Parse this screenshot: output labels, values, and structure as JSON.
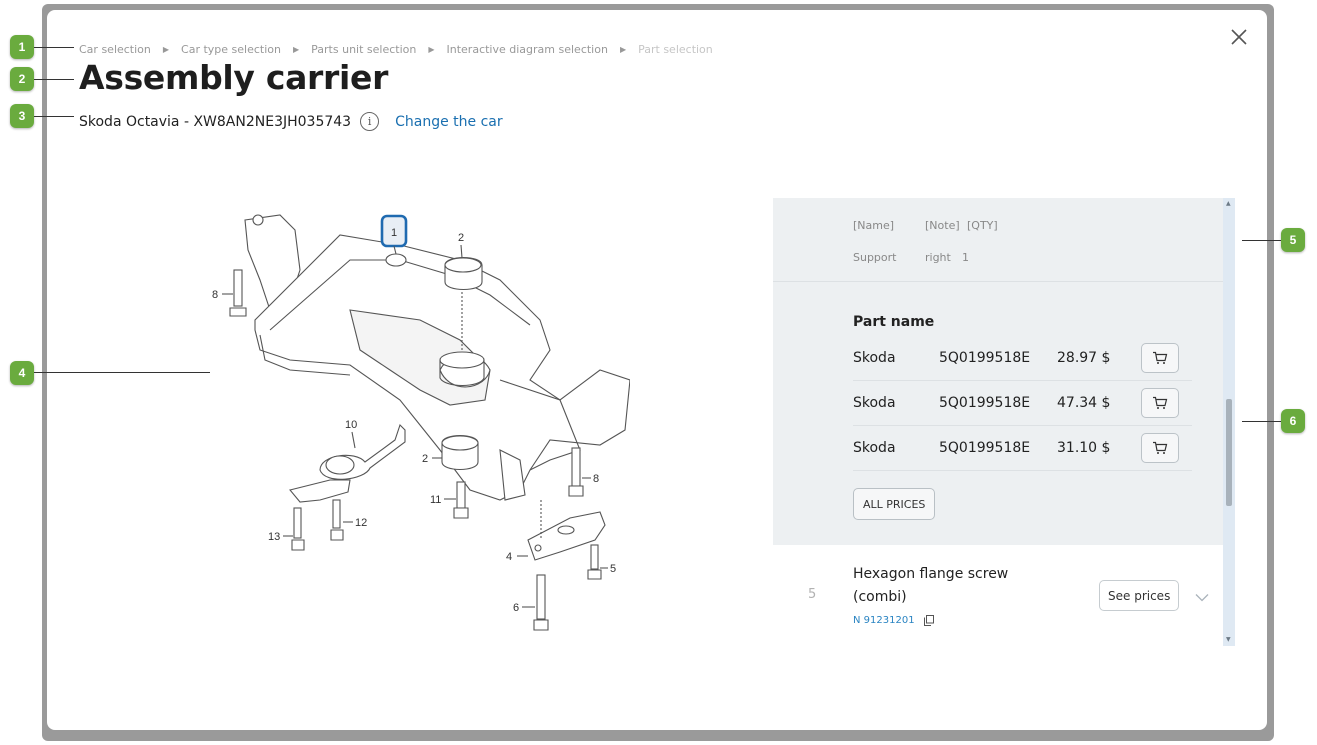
{
  "breadcrumb": [
    {
      "label": "Car selection"
    },
    {
      "label": "Car type selection"
    },
    {
      "label": "Parts unit selection"
    },
    {
      "label": "Interactive diagram selection"
    },
    {
      "label": "Part selection"
    }
  ],
  "title": "Assembly carrier",
  "car": {
    "name": "Skoda Octavia - XW8AN2NE3JH035743",
    "change_label": "Change the car"
  },
  "callouts": [
    "1",
    "2",
    "3",
    "4",
    "5",
    "6"
  ],
  "diagram": {
    "selected_label": "1",
    "labels": [
      "1",
      "2",
      "8",
      "10",
      "2",
      "11",
      "12",
      "13",
      "4",
      "5",
      "6",
      "8"
    ]
  },
  "panel": {
    "headers": [
      "[Name]",
      "[Note]",
      "[QTY]"
    ],
    "header_values": {
      "name": "Support",
      "note": "right",
      "qty": "1"
    },
    "part_name_label": "Part name",
    "prices": [
      {
        "brand": "Skoda",
        "code": "5Q0199518E",
        "price": "28.97 $"
      },
      {
        "brand": "Skoda",
        "code": "5Q0199518E",
        "price": "47.34 $"
      },
      {
        "brand": "Skoda",
        "code": "5Q0199518E",
        "price": "31.10 $"
      }
    ],
    "all_prices_label": "ALL PRICES",
    "next_item": {
      "number": "5",
      "title": "Hexagon flange screw (combi)",
      "code": "N 91231201",
      "see_prices_label": "See prices"
    }
  },
  "colors": {
    "callout": "#6aab3e",
    "link": "#1a6fb0",
    "highlight": "#1f6ab0",
    "panel": "#edf0f2"
  }
}
